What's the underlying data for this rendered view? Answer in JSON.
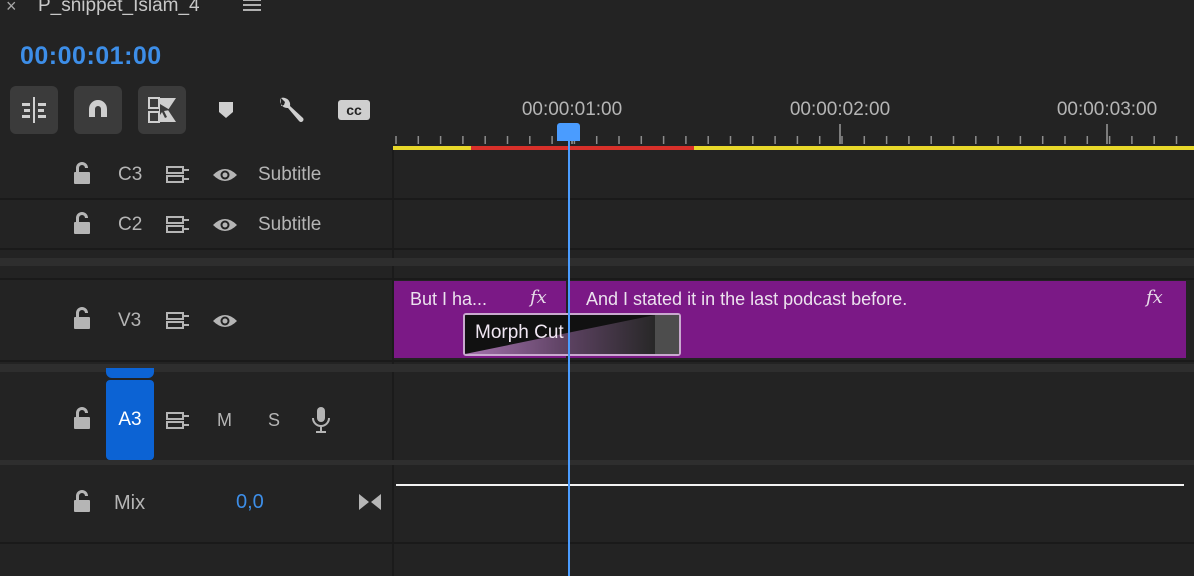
{
  "header": {
    "close_glyph": "×",
    "sequence_title": "P_snippet_Islam_4",
    "menu_icon": "hamburger-menu-icon",
    "timecode": "00:00:01:00"
  },
  "toolbar": {
    "icons": [
      "insert-overwrite-sequences-icon",
      "snap-magnet-icon",
      "linked-selection-icon",
      "add-marker-icon",
      "wrench-settings-icon",
      "captions-icon"
    ],
    "cc_label": "cc"
  },
  "ruler": {
    "labels": [
      "00:00:01:00",
      "00:00:02:00",
      "00:00:03:00"
    ],
    "playhead_time": "00:00:01:00"
  },
  "tracks": {
    "c3": {
      "name": "C3",
      "label": "Subtitle"
    },
    "c2": {
      "name": "C2",
      "label": "Subtitle"
    },
    "v3": {
      "name": "V3"
    },
    "a3": {
      "name": "A3",
      "mute": "M",
      "solo": "S"
    },
    "mix": {
      "name": "Mix",
      "value": "0,0"
    }
  },
  "clips": {
    "clip1": {
      "text": "But I ha...",
      "fx": "fx"
    },
    "clip2": {
      "text": "And I stated it in the last podcast before.",
      "fx": "fx"
    },
    "transition": {
      "label": "Morph Cut"
    }
  },
  "colors": {
    "accent_blue": "#3d8ee8",
    "clip_purple": "#7b1986",
    "render_bar_yellow": "#e8d82a",
    "render_bar_red": "#d8302a"
  }
}
